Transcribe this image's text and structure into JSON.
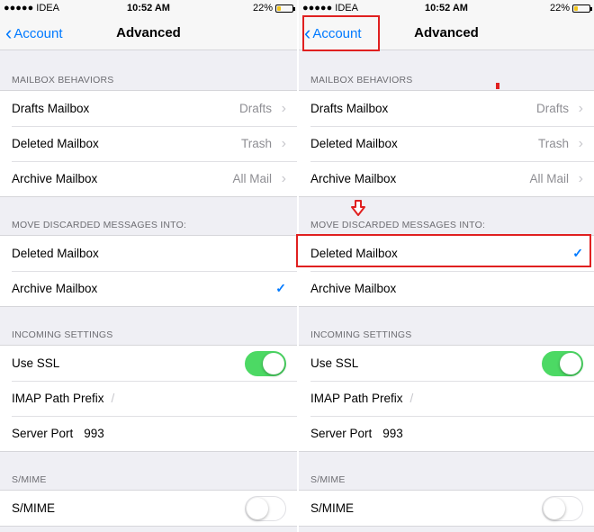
{
  "status": {
    "carrier": "●●●●● IDEA",
    "time": "10:52 AM",
    "battery": "22%",
    "battery_level": 0.22
  },
  "nav": {
    "back_label": "Account",
    "title": "Advanced"
  },
  "mailbox_behaviors": {
    "header": "MAILBOX BEHAVIORS",
    "rows": [
      {
        "label": "Drafts Mailbox",
        "value": "Drafts"
      },
      {
        "label": "Deleted Mailbox",
        "value": "Trash"
      },
      {
        "label": "Archive Mailbox",
        "value": "All Mail"
      }
    ]
  },
  "move_discarded": {
    "header": "MOVE DISCARDED MESSAGES INTO:",
    "options": [
      "Deleted Mailbox",
      "Archive Mailbox"
    ],
    "left_selected": "Archive Mailbox",
    "right_selected": "Deleted Mailbox"
  },
  "incoming": {
    "header": "INCOMING SETTINGS",
    "use_ssl_label": "Use SSL",
    "use_ssl_on": true,
    "imap_label": "IMAP Path Prefix",
    "imap_value": "/",
    "port_label": "Server Port",
    "port_value": "993"
  },
  "smime": {
    "header": "S/MIME",
    "label": "S/MIME",
    "on": false
  },
  "annotation_color": "#e02020",
  "accent_color": "#007aff"
}
